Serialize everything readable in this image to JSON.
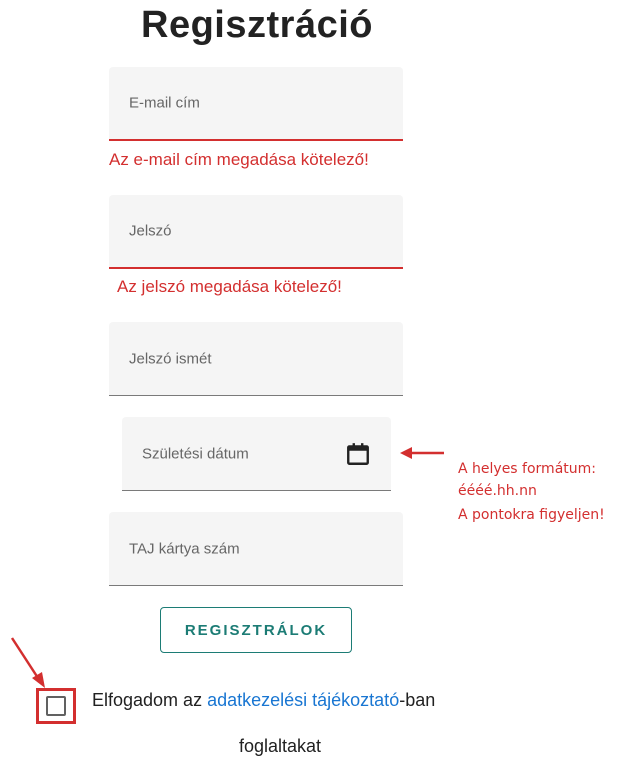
{
  "page": {
    "title": "Regisztráció"
  },
  "form": {
    "email": {
      "label": "E-mail cím",
      "error": "Az e-mail cím megadása kötelező!"
    },
    "password": {
      "label": "Jelszó",
      "error": "Az jelszó megadása kötelező!"
    },
    "password_confirm": {
      "label": "Jelszó ismét"
    },
    "birth_date": {
      "label": "Születési dátum",
      "icon": "calendar-icon"
    },
    "taj": {
      "label": "TAJ kártya szám"
    },
    "submit_label": "REGISZTRÁLOK"
  },
  "consent": {
    "prefix": "Elfogadom az ",
    "link": "adatkezelési tájékoztató",
    "suffix": "-ban",
    "line2": "foglaltakat",
    "checked": false
  },
  "annotations": {
    "format_note_1": "A helyes formátum:",
    "format_note_2": "éééé.hh.nn",
    "dots_note": "A pontokra figyeljen!",
    "color": "#d32f2f"
  },
  "colors": {
    "accent": "#1c7c75",
    "error": "#d32f2f",
    "link": "#1976d2"
  }
}
